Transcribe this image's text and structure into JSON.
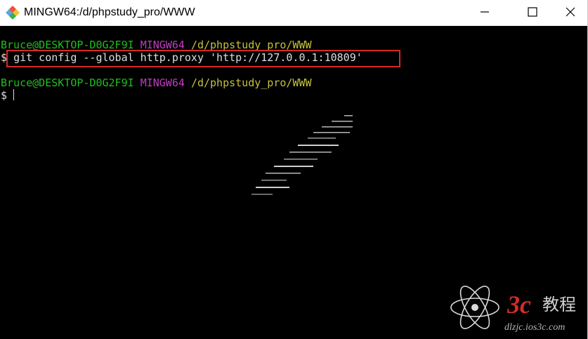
{
  "window": {
    "title": "MINGW64:/d/phpstudy_pro/WWW"
  },
  "terminal": {
    "prompt1": {
      "user_host": "Bruce@DESKTOP-D0G2F9I",
      "system": "MINGW64",
      "path": "/d/phpstudy_pro/WWW"
    },
    "command_line": {
      "symbol": "$",
      "command": "git config --global http.proxy 'http://127.0.0.1:10809'"
    },
    "prompt2": {
      "user_host": "Bruce@DESKTOP-D0G2F9I",
      "system": "MINGW64",
      "path": "/d/phpstudy_pro/WWW"
    },
    "input_line": {
      "symbol": "$",
      "current_input": ""
    },
    "colors": {
      "background": "#000000",
      "user_host": "#1fc01f",
      "system": "#c33ac3",
      "path": "#c6c13b",
      "text": "#dedede",
      "highlight": "#d42a2a"
    }
  },
  "icons": {
    "app": "git-bash-icon",
    "minimize": "minimize-icon",
    "maximize": "maximize-icon",
    "close": "close-icon"
  },
  "watermark": {
    "brand": "3c",
    "cjk": "教程",
    "site": "dlzjc.ios3c.com",
    "color": "#d42a2a"
  }
}
